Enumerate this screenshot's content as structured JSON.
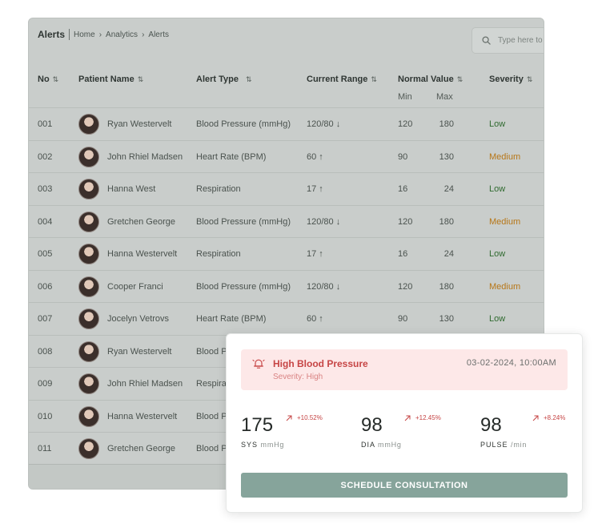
{
  "header": {
    "title": "Alerts",
    "breadcrumbs": [
      "Home",
      "Analytics",
      "Alerts"
    ],
    "search_placeholder": "Type here to search"
  },
  "columns": {
    "no": "No",
    "patient": "Patient Name",
    "alert_type": "Alert Type",
    "current_range": "Current Range",
    "normal_value": "Normal Value",
    "normal_min": "Min",
    "normal_max": "Max",
    "severity": "Severity"
  },
  "rows": [
    {
      "no": "001",
      "name": "Ryan Westervelt",
      "type": "Blood Pressure (mmHg)",
      "range": "120/80 ↓",
      "min": "120",
      "max": "180",
      "severity": "Low"
    },
    {
      "no": "002",
      "name": "John Rhiel Madsen",
      "type": "Heart Rate (BPM)",
      "range": "60 ↑",
      "min": "90",
      "max": "130",
      "severity": "Medium"
    },
    {
      "no": "003",
      "name": "Hanna West",
      "type": "Respiration",
      "range": "17 ↑",
      "min": "16",
      "max": "24",
      "severity": "Low"
    },
    {
      "no": "004",
      "name": "Gretchen George",
      "type": "Blood Pressure (mmHg)",
      "range": "120/80 ↓",
      "min": "120",
      "max": "180",
      "severity": "Medium"
    },
    {
      "no": "005",
      "name": "Hanna Westervelt",
      "type": "Respiration",
      "range": "17 ↑",
      "min": "16",
      "max": "24",
      "severity": "Low"
    },
    {
      "no": "006",
      "name": "Cooper Franci",
      "type": "Blood Pressure (mmHg)",
      "range": "120/80 ↓",
      "min": "120",
      "max": "180",
      "severity": "Medium"
    },
    {
      "no": "007",
      "name": "Jocelyn Vetrovs",
      "type": "Heart Rate (BPM)",
      "range": "60 ↑",
      "min": "90",
      "max": "130",
      "severity": "Low"
    },
    {
      "no": "008",
      "name": "Ryan Westervelt",
      "type": "Blood P",
      "range": "",
      "min": "",
      "max": "",
      "severity": ""
    },
    {
      "no": "009",
      "name": "John Rhiel Madsen",
      "type": "Respira",
      "range": "",
      "min": "",
      "max": "",
      "severity": ""
    },
    {
      "no": "010",
      "name": "Hanna Westervelt",
      "type": "Blood P",
      "range": "",
      "min": "",
      "max": "",
      "severity": ""
    },
    {
      "no": "011",
      "name": "Gretchen George",
      "type": "Blood P",
      "range": "",
      "min": "",
      "max": "",
      "severity": ""
    }
  ],
  "alert": {
    "title": "High Blood Pressure",
    "severity_text": "Severity: High",
    "datetime": "03-02-2024, 10:00AM",
    "metrics": [
      {
        "value": "175",
        "label": "SYS",
        "unit": "mmHg",
        "change": "+10.52%"
      },
      {
        "value": "98",
        "label": "DIA",
        "unit": "mmHg",
        "change": "+12.45%"
      },
      {
        "value": "98",
        "label": "PULSE",
        "unit": "/min",
        "change": "+8.24%"
      }
    ],
    "cta_label": "SCHEDULE CONSULTATION"
  },
  "colors": {
    "accent": "#86a49b",
    "alert_red": "#c64545",
    "alert_bg": "#fde8e8",
    "severity_low": "#2f6a2f",
    "severity_medium": "#b77617"
  }
}
